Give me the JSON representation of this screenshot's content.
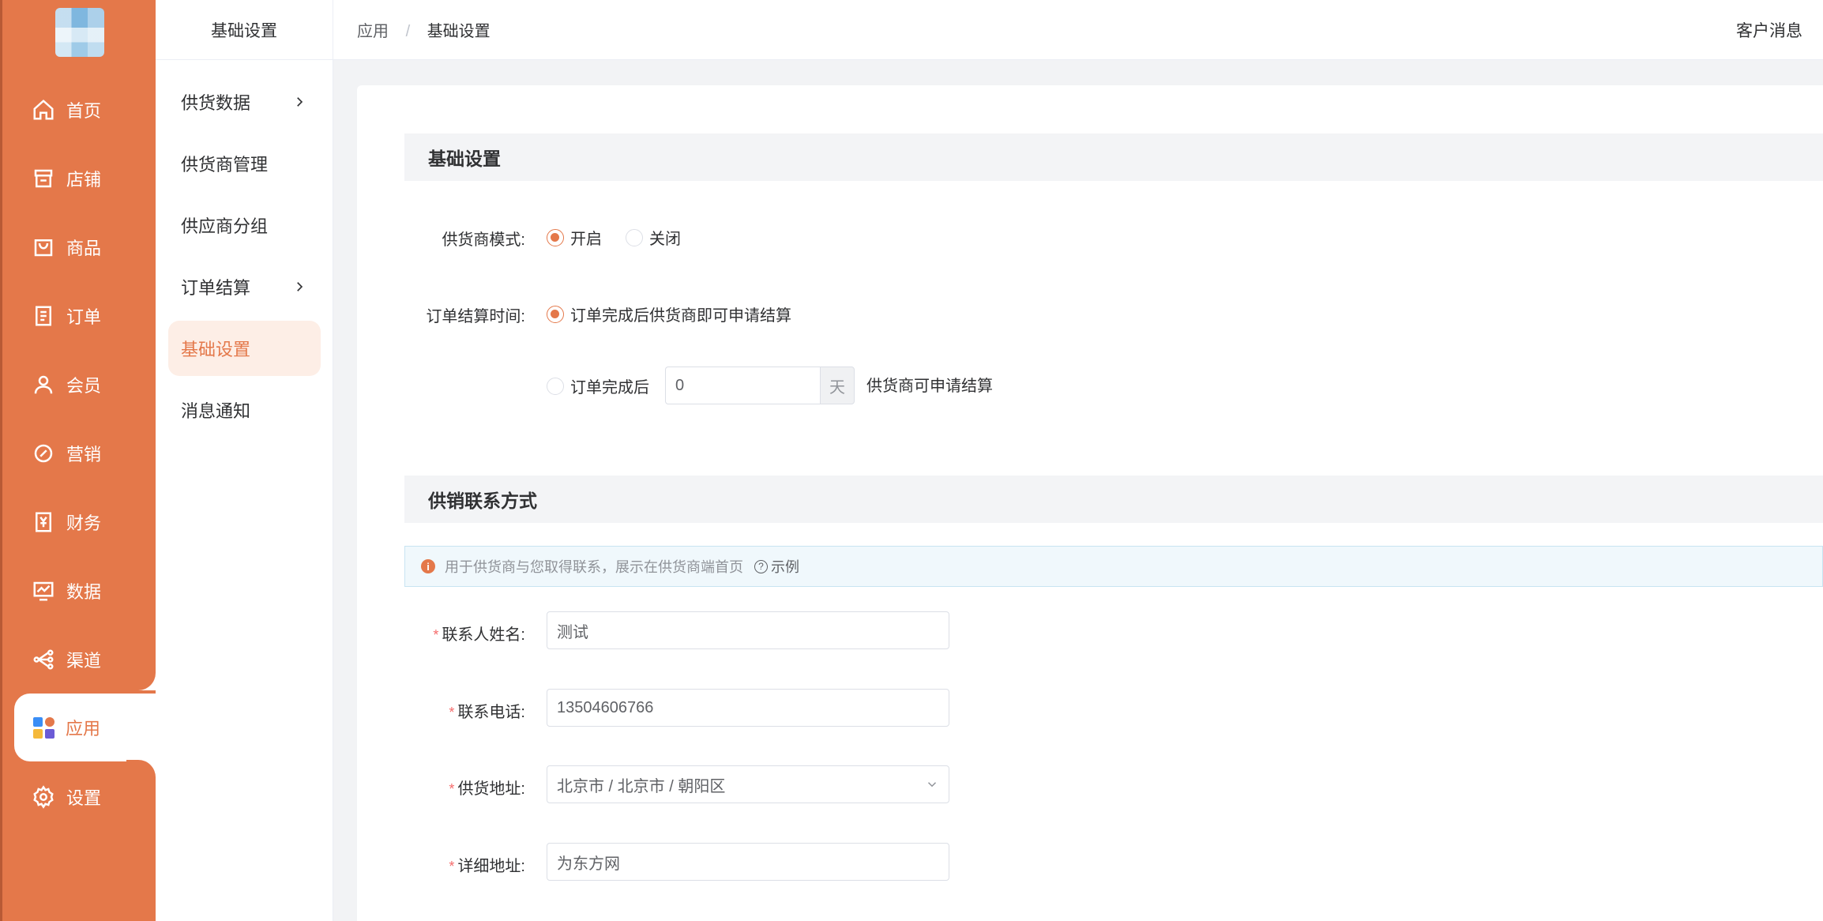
{
  "rail": {
    "items": [
      {
        "label": "首页",
        "icon": "home-icon"
      },
      {
        "label": "店铺",
        "icon": "store-icon"
      },
      {
        "label": "商品",
        "icon": "bag-icon"
      },
      {
        "label": "订单",
        "icon": "order-icon"
      },
      {
        "label": "会员",
        "icon": "user-icon"
      },
      {
        "label": "营销",
        "icon": "marketing-icon"
      },
      {
        "label": "财务",
        "icon": "finance-icon"
      },
      {
        "label": "数据",
        "icon": "data-icon"
      },
      {
        "label": "渠道",
        "icon": "channel-icon"
      },
      {
        "label": "应用",
        "icon": "apps-icon"
      },
      {
        "label": "设置",
        "icon": "settings-icon"
      }
    ],
    "active": "应用"
  },
  "subnav": {
    "title": "基础设置",
    "items": [
      {
        "label": "供货数据",
        "has_arrow": true
      },
      {
        "label": "供货商管理",
        "has_arrow": false
      },
      {
        "label": "供应商分组",
        "has_arrow": false
      },
      {
        "label": "订单结算",
        "has_arrow": true
      },
      {
        "label": "基础设置",
        "has_arrow": false
      },
      {
        "label": "消息通知",
        "has_arrow": false
      }
    ],
    "active": "基础设置"
  },
  "breadcrumb": {
    "parent": "应用",
    "separator": "/",
    "current": "基础设置"
  },
  "top_right": "客户消息",
  "basic": {
    "title": "基础设置",
    "supplier_mode": {
      "label": "供货商模式:",
      "options": [
        "开启",
        "关闭"
      ],
      "selected": "开启"
    },
    "settle_time": {
      "label": "订单结算时间:",
      "option_1": "订单完成后供货商即可申请结算",
      "option_2_prefix": "订单完成后",
      "days_value": "0",
      "days_unit": "天",
      "option_2_suffix": "供货商可申请结算",
      "selected": "option_1"
    }
  },
  "contact": {
    "title": "供销联系方式",
    "info": "用于供货商与您取得联系，展示在供货商端首页",
    "example_link": "示例",
    "name_label": "联系人姓名:",
    "name_value": "测试",
    "phone_label": "联系电话:",
    "phone_value": "13504606766",
    "region_label": "供货地址:",
    "region_value": "北京市 / 北京市 / 朝阳区",
    "address_label": "详细地址:",
    "address_value": "为东方网"
  },
  "colors": {
    "accent": "#e4784a",
    "active_bg": "#fdeee6",
    "section_bg": "#f3f4f6"
  }
}
